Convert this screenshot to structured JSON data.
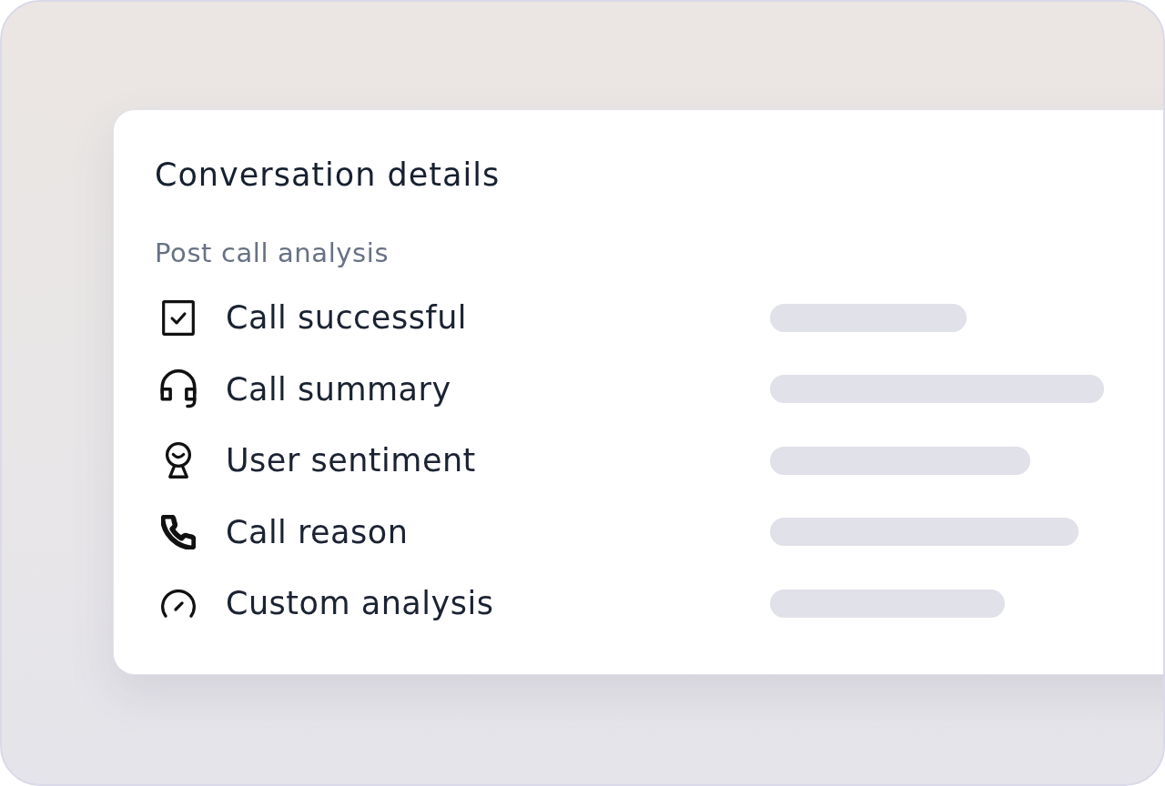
{
  "card": {
    "title": "Conversation details",
    "section": {
      "label": "Post call analysis",
      "items": [
        {
          "label": "Call successful",
          "loading": true
        },
        {
          "label": "Call summary",
          "loading": true
        },
        {
          "label": "User sentiment",
          "loading": true
        },
        {
          "label": "Call reason",
          "loading": true
        },
        {
          "label": "Custom analysis",
          "loading": true
        }
      ]
    }
  }
}
